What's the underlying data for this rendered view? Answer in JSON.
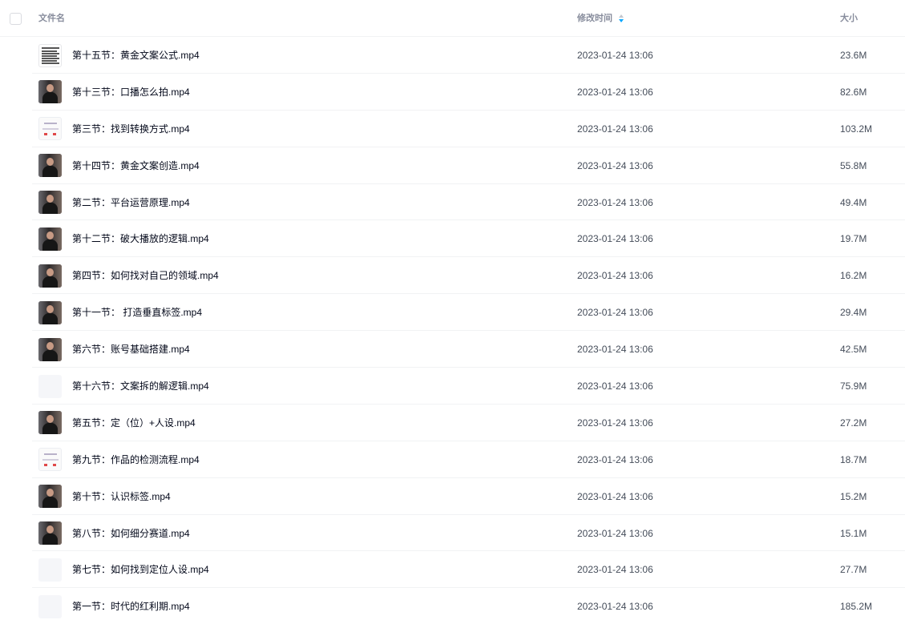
{
  "header": {
    "name_label": "文件名",
    "time_label": "修改时间",
    "size_label": "大小",
    "sort_icon": "sort-descending-icon"
  },
  "colors": {
    "sort_accent": "#06a7ff",
    "sort_muted": "#c4c7ce"
  },
  "files": [
    {
      "name": "第十五节：黄金文案公式.mp4",
      "time": "2023-01-24 13:06",
      "size": "23.6M",
      "thumb": "doc"
    },
    {
      "name": "第十三节：口播怎么拍.mp4",
      "time": "2023-01-24 13:06",
      "size": "82.6M",
      "thumb": "person"
    },
    {
      "name": "第三节：找到转换方式.mp4",
      "time": "2023-01-24 13:06",
      "size": "103.2M",
      "thumb": "slide"
    },
    {
      "name": "第十四节：黄金文案创造.mp4",
      "time": "2023-01-24 13:06",
      "size": "55.8M",
      "thumb": "person"
    },
    {
      "name": "第二节：平台运营原理.mp4",
      "time": "2023-01-24 13:06",
      "size": "49.4M",
      "thumb": "person"
    },
    {
      "name": "第十二节：破大播放的逻辑.mp4",
      "time": "2023-01-24 13:06",
      "size": "19.7M",
      "thumb": "person"
    },
    {
      "name": "第四节：如何找对自己的领域.mp4",
      "time": "2023-01-24 13:06",
      "size": "16.2M",
      "thumb": "person"
    },
    {
      "name": "第十一节： 打造垂直标签.mp4",
      "time": "2023-01-24 13:06",
      "size": "29.4M",
      "thumb": "person"
    },
    {
      "name": "第六节：账号基础搭建.mp4",
      "time": "2023-01-24 13:06",
      "size": "42.5M",
      "thumb": "person"
    },
    {
      "name": "第十六节：文案拆的解逻辑.mp4",
      "time": "2023-01-24 13:06",
      "size": "75.9M",
      "thumb": "blank"
    },
    {
      "name": "第五节：定（位）+人设.mp4",
      "time": "2023-01-24 13:06",
      "size": "27.2M",
      "thumb": "person"
    },
    {
      "name": "第九节：作品的检测流程.mp4",
      "time": "2023-01-24 13:06",
      "size": "18.7M",
      "thumb": "slide"
    },
    {
      "name": "第十节：认识标签.mp4",
      "time": "2023-01-24 13:06",
      "size": "15.2M",
      "thumb": "person"
    },
    {
      "name": "第八节：如何细分赛道.mp4",
      "time": "2023-01-24 13:06",
      "size": "15.1M",
      "thumb": "person"
    },
    {
      "name": "第七节：如何找到定位人设.mp4",
      "time": "2023-01-24 13:06",
      "size": "27.7M",
      "thumb": "blank"
    },
    {
      "name": "第一节：时代的红利期.mp4",
      "time": "2023-01-24 13:06",
      "size": "185.2M",
      "thumb": "blank"
    }
  ]
}
